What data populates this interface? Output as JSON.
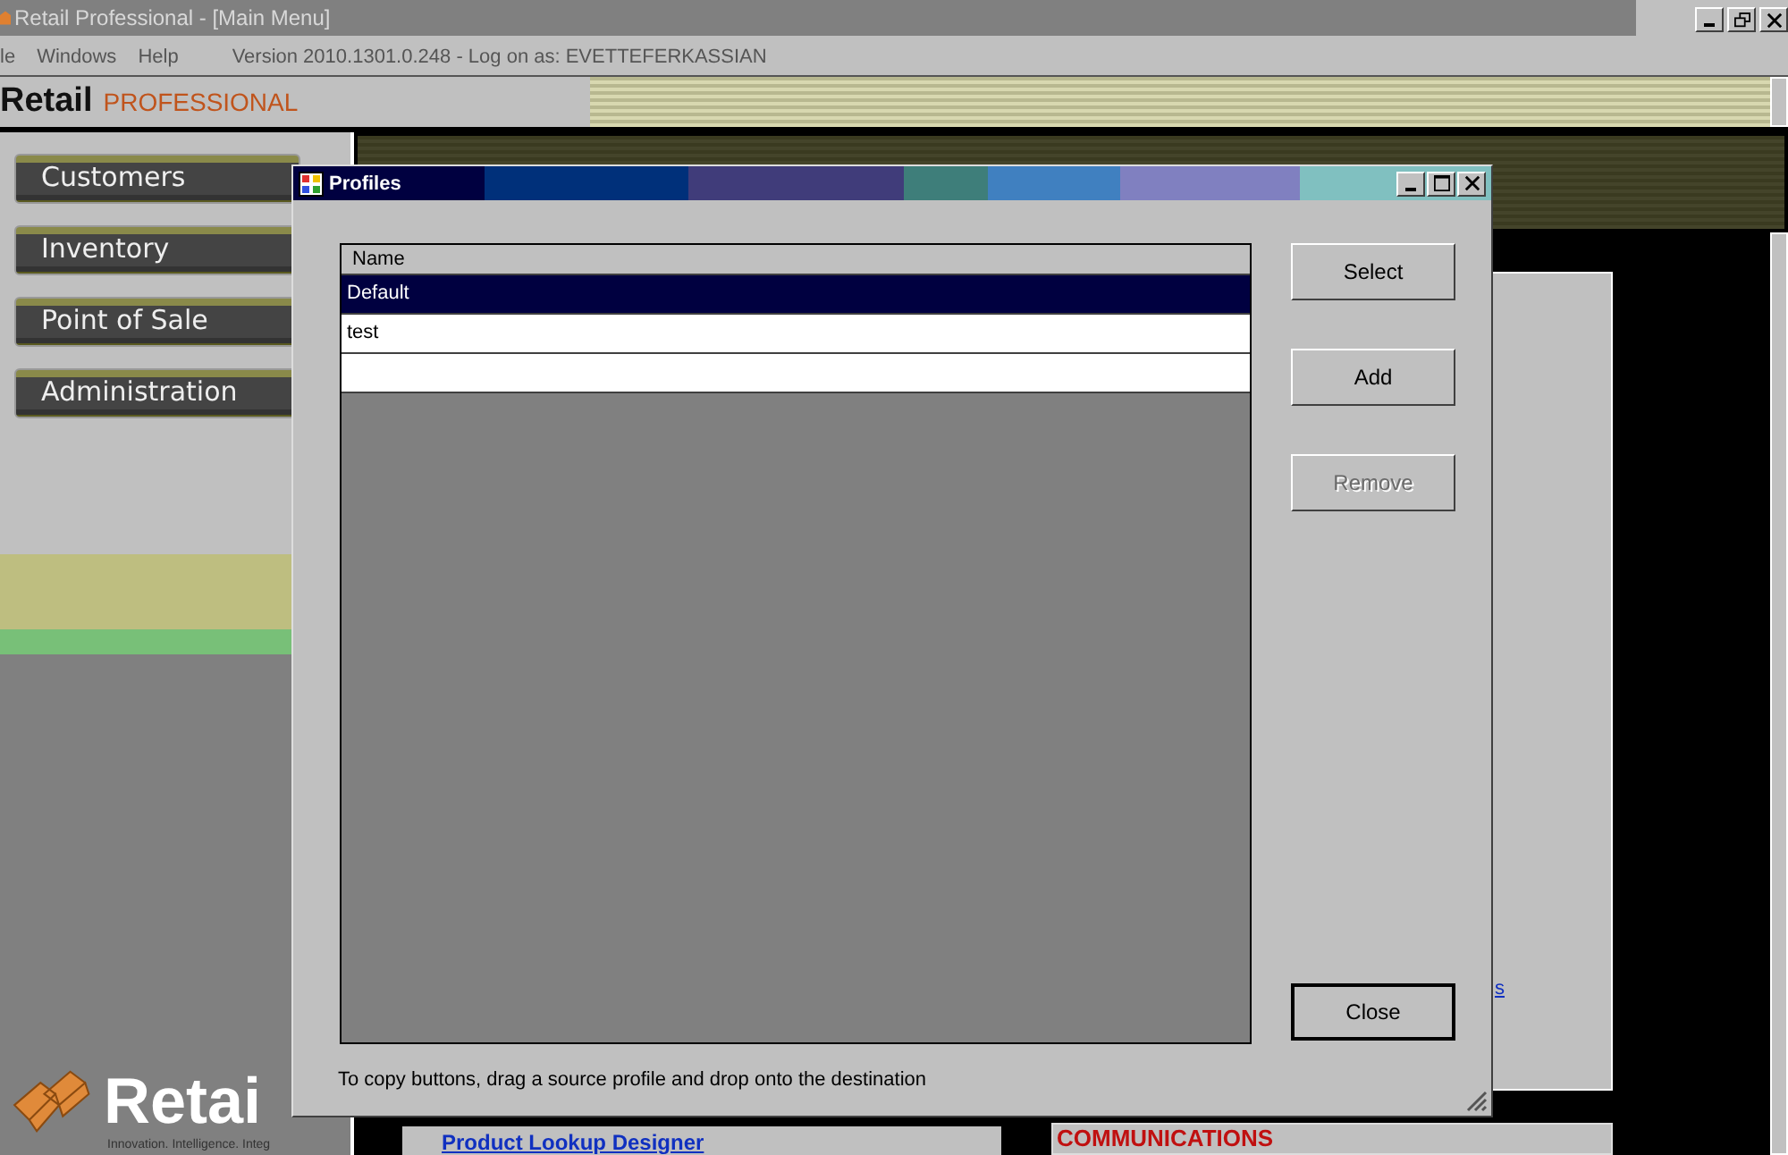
{
  "app_window": {
    "title": "Retail Professional - [Main Menu]"
  },
  "menu": [
    {
      "label": "le"
    },
    {
      "label": "Windows"
    },
    {
      "label": "Help"
    }
  ],
  "version_text": "Version 2010.1301.0.248 - Log on as: EVETTEFERKASSIAN",
  "header": {
    "brand": "Retail",
    "product": "PROFESSIONAL"
  },
  "nav": [
    {
      "label": "Customers"
    },
    {
      "label": "Inventory"
    },
    {
      "label": "Point of Sale"
    },
    {
      "label": "Administration"
    }
  ],
  "footer_logo": {
    "brand": "Retai",
    "tagline": "Innovation. Intelligence. Integ"
  },
  "background_links": [
    {
      "label": "s"
    },
    {
      "label": "Product Lookup Designer"
    }
  ],
  "background_heading": "COMMUNICATIONS",
  "dialog": {
    "title": "Profiles",
    "column": "Name",
    "rows": [
      {
        "name": "Default",
        "selected": true
      },
      {
        "name": "test",
        "selected": false
      }
    ],
    "buttons": [
      {
        "label": "Select",
        "disabled": false
      },
      {
        "label": "Add",
        "disabled": false
      },
      {
        "label": "Remove",
        "disabled": true
      }
    ],
    "close": "Close",
    "hint": "To copy buttons, drag a source profile and drop onto the destination"
  }
}
